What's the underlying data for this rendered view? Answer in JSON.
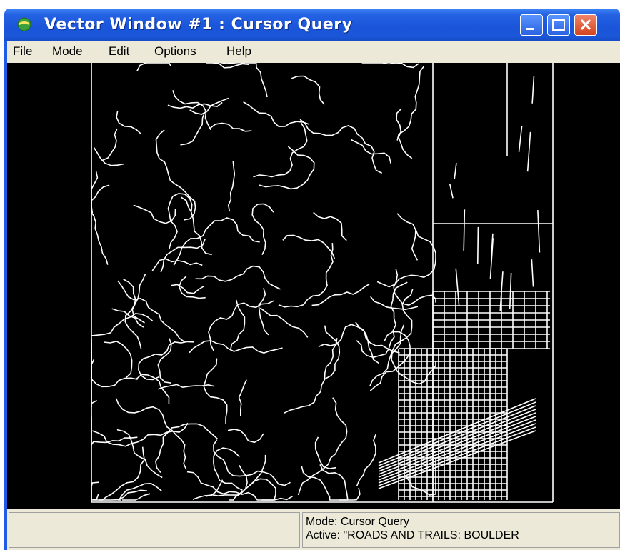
{
  "window": {
    "title": "Vector Window #1 : Cursor Query",
    "icon": "globe-icon"
  },
  "menu": {
    "items": [
      "File",
      "Mode",
      "Edit",
      "Options",
      "Help"
    ]
  },
  "status": {
    "mode": "Mode: Cursor Query",
    "active": "Active: \"ROADS AND TRAILS: BOULDER"
  },
  "colors": {
    "titlebar": "#1f5be6",
    "map_background": "#000000",
    "map_lines": "#ffffff",
    "chrome": "#ece9d8"
  }
}
